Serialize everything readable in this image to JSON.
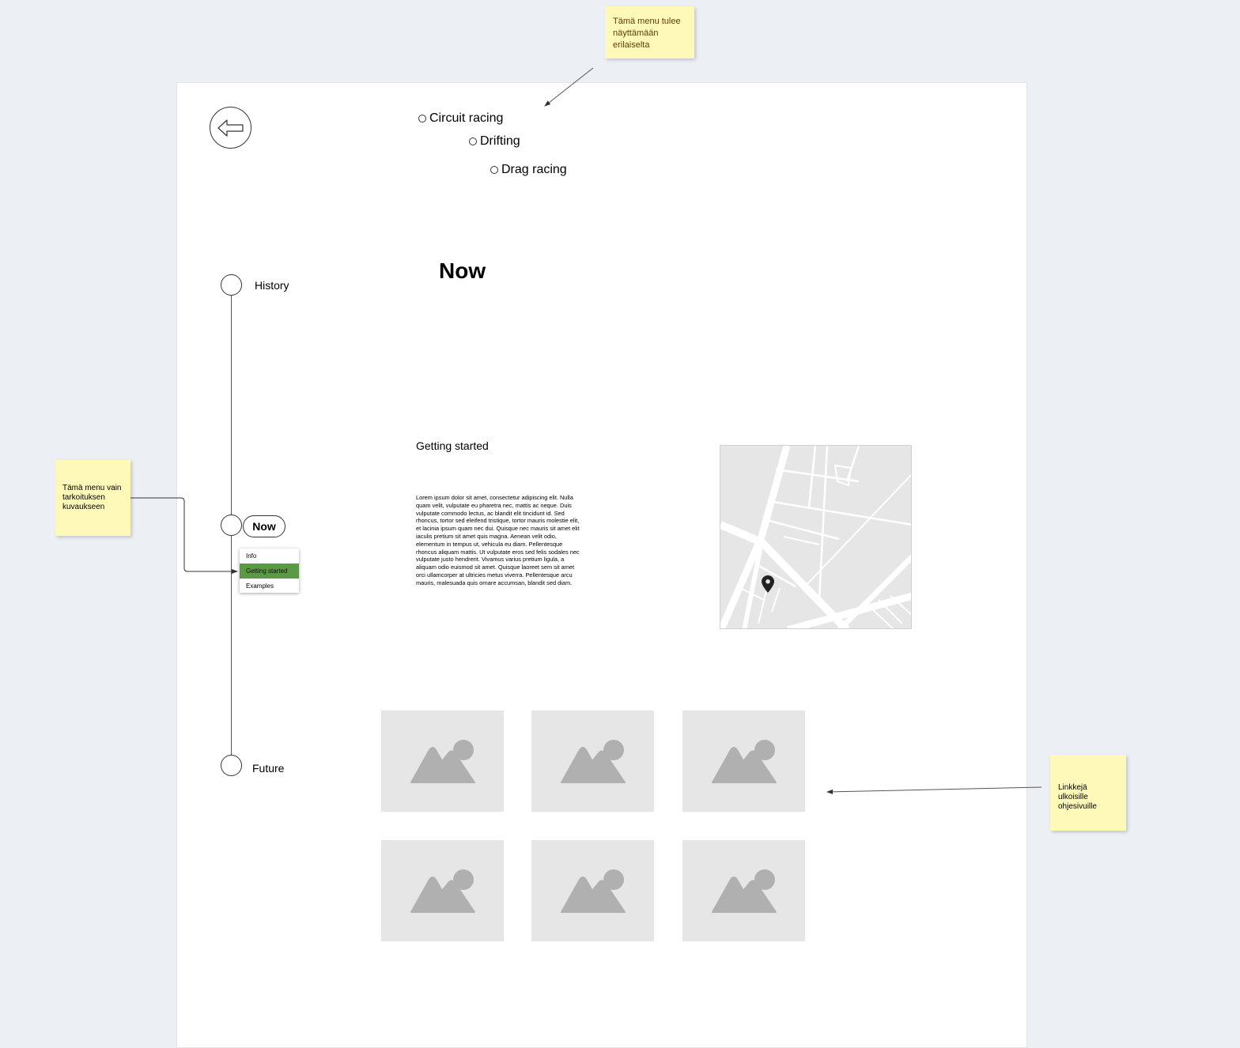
{
  "notes": {
    "top": "Tämä menu tulee näyttämään erilaiselta",
    "left": "Tämä menu vain tarkoituksen kuvaukseen",
    "right": "Linkkejä ulkoisille ohjesivuille"
  },
  "category_menu": {
    "items": [
      {
        "label": "Circuit racing"
      },
      {
        "label": "Drifting"
      },
      {
        "label": "Drag racing"
      }
    ]
  },
  "timeline": {
    "history": "History",
    "now": "Now",
    "future": "Future",
    "submenu": [
      {
        "label": "Info"
      },
      {
        "label": "Getting started",
        "active": true
      },
      {
        "label": "Examples"
      }
    ],
    "active_color": "#5b9a45"
  },
  "main": {
    "title": "Now",
    "section_heading": "Getting started",
    "body": "Lorem ipsum dolor sit amet, consectetur adipiscing elit. Nulla quam velit, vulputate eu pharetra nec, mattis ac neque. Duis vulputate commodo lectus, ac blandit elit tincidunt id. Sed rhoncus, tortor sed eleifend tristique, tortor mauris molestie elit, et lacinia ipsum quam nec dui. Quisque nec mauris sit amet elit iaculis pretium sit amet quis magna. Aenean velit odio, elementum in tempus ut, vehicula eu diam. Pellentesque rhoncus aliquam mattis. Ut vulputate eros sed felis sodales nec vulputate justo hendrerit. Vivamus varius pretium ligula, a aliquam odio euismod sit amet. Quisque laoreet sem sit amet orci ullamcorper at ultricies metus viverra. Pellentesque arcu mauris, malesuada quis ornare accumsan, blandit sed diam."
  },
  "icons": {
    "back": "arrow-left-icon",
    "map_marker": "map-pin-icon",
    "image_placeholder": "image-placeholder-icon"
  },
  "colors": {
    "canvas_bg": "#eceff4",
    "sticky_note": "#fff9b9",
    "placeholder": "#e6e6e6"
  }
}
